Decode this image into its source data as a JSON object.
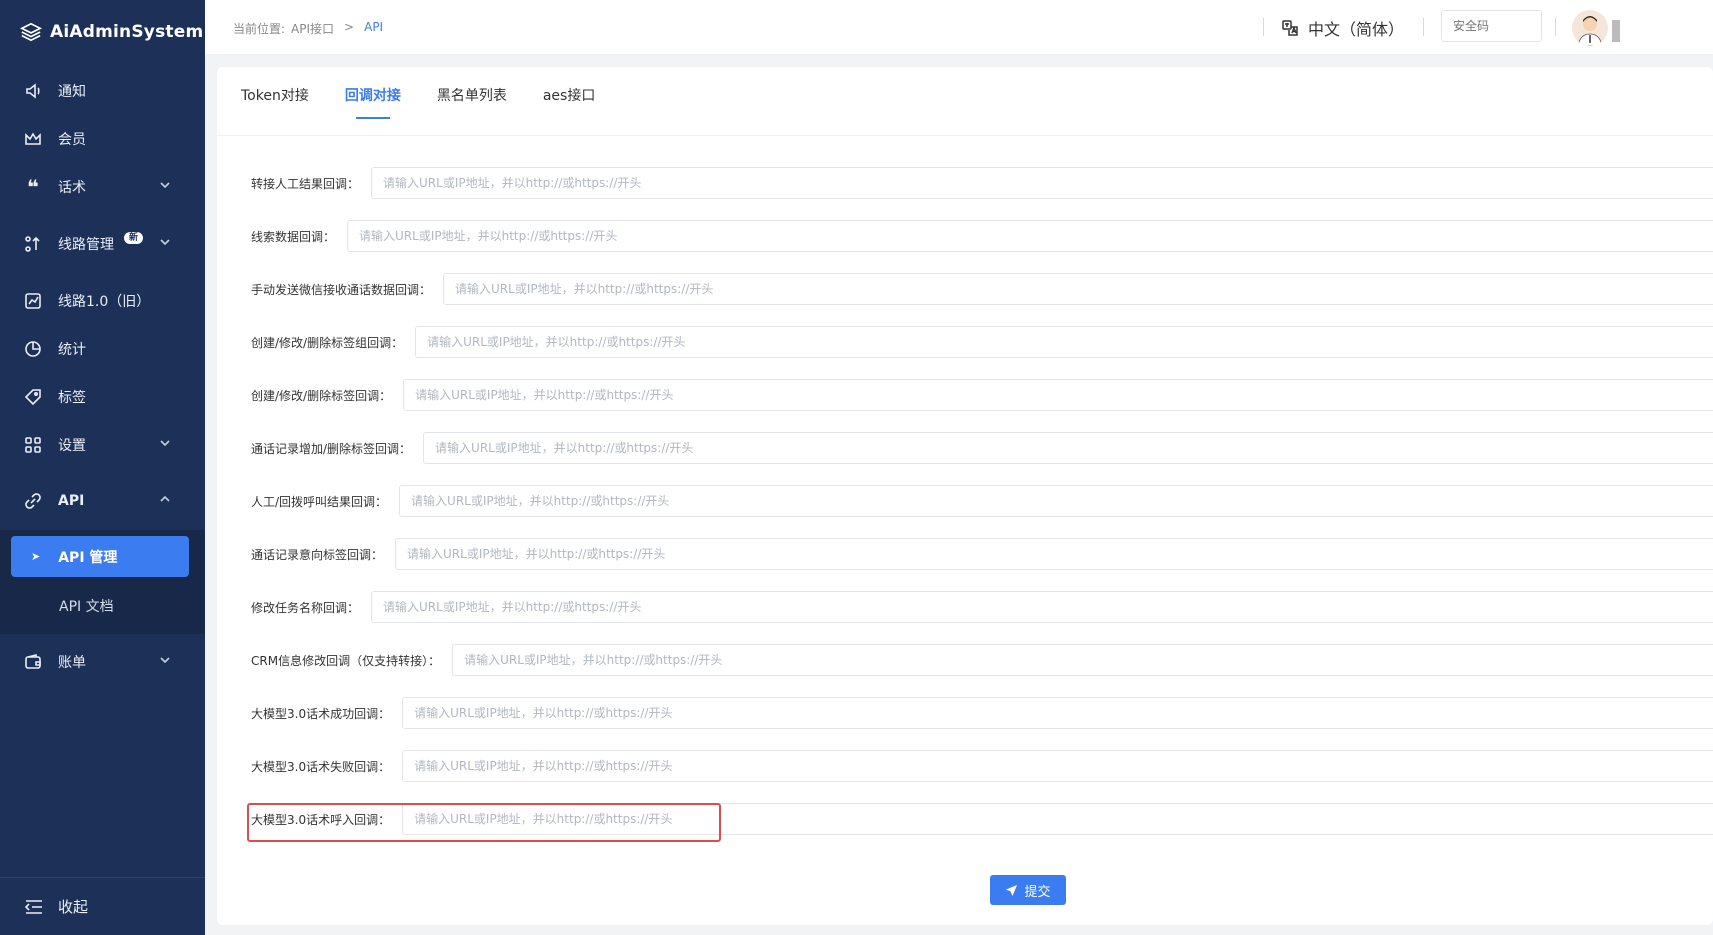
{
  "app": {
    "name": "AiAdminSystem"
  },
  "sidebar": {
    "items": [
      {
        "label": "通知",
        "icon": "speaker-icon"
      },
      {
        "label": "会员",
        "icon": "crown-icon"
      },
      {
        "label": "话术",
        "icon": "quote-icon",
        "expandable": true
      },
      {
        "label": "线路管理",
        "icon": "route-icon",
        "badge": "新",
        "expandable": true
      },
      {
        "label": "线路1.0（旧）",
        "icon": "chart-icon"
      },
      {
        "label": "统计",
        "icon": "pie-icon"
      },
      {
        "label": "标签",
        "icon": "tag-icon"
      },
      {
        "label": "设置",
        "icon": "grid-icon",
        "expandable": true
      },
      {
        "label": "API",
        "icon": "link-icon",
        "expanded": true
      },
      {
        "label": "账单",
        "icon": "wallet-icon",
        "expandable": true
      }
    ],
    "api_sub": [
      {
        "label": "API 管理",
        "active": true
      },
      {
        "label": "API 文档"
      }
    ],
    "collapse_label": "收起"
  },
  "header": {
    "breadcrumb": {
      "prefix": "当前位置:",
      "parent": "API接口",
      "separator": ">",
      "current": "API"
    },
    "language": "中文（简体）",
    "security_code_placeholder": "安全码"
  },
  "tabs": [
    {
      "label": "Token对接"
    },
    {
      "label": "回调对接",
      "active": true
    },
    {
      "label": "黑名单列表"
    },
    {
      "label": "aes接口"
    }
  ],
  "form": {
    "placeholder": "请输入URL或IP地址，并以http://或https://开头",
    "fields": [
      {
        "label": "转接人工结果回调："
      },
      {
        "label": "线索数据回调："
      },
      {
        "label": "手动发送微信接收通话数据回调："
      },
      {
        "label": "创建/修改/删除标签组回调："
      },
      {
        "label": "创建/修改/删除标签回调："
      },
      {
        "label": "通话记录增加/删除标签回调："
      },
      {
        "label": "人工/回拨呼叫结果回调："
      },
      {
        "label": "通话记录意向标签回调："
      },
      {
        "label": "修改任务名称回调："
      },
      {
        "label": "CRM信息修改回调（仅支持转接）："
      },
      {
        "label": "大模型3.0话术成功回调："
      },
      {
        "label": "大模型3.0话术失败回调："
      },
      {
        "label": "大模型3.0话术呼入回调："
      }
    ],
    "submit_label": "提交"
  },
  "colors": {
    "sidebar_bg": "#1d3158",
    "accent": "#3b7cf0",
    "highlight": "#e34b4b"
  }
}
